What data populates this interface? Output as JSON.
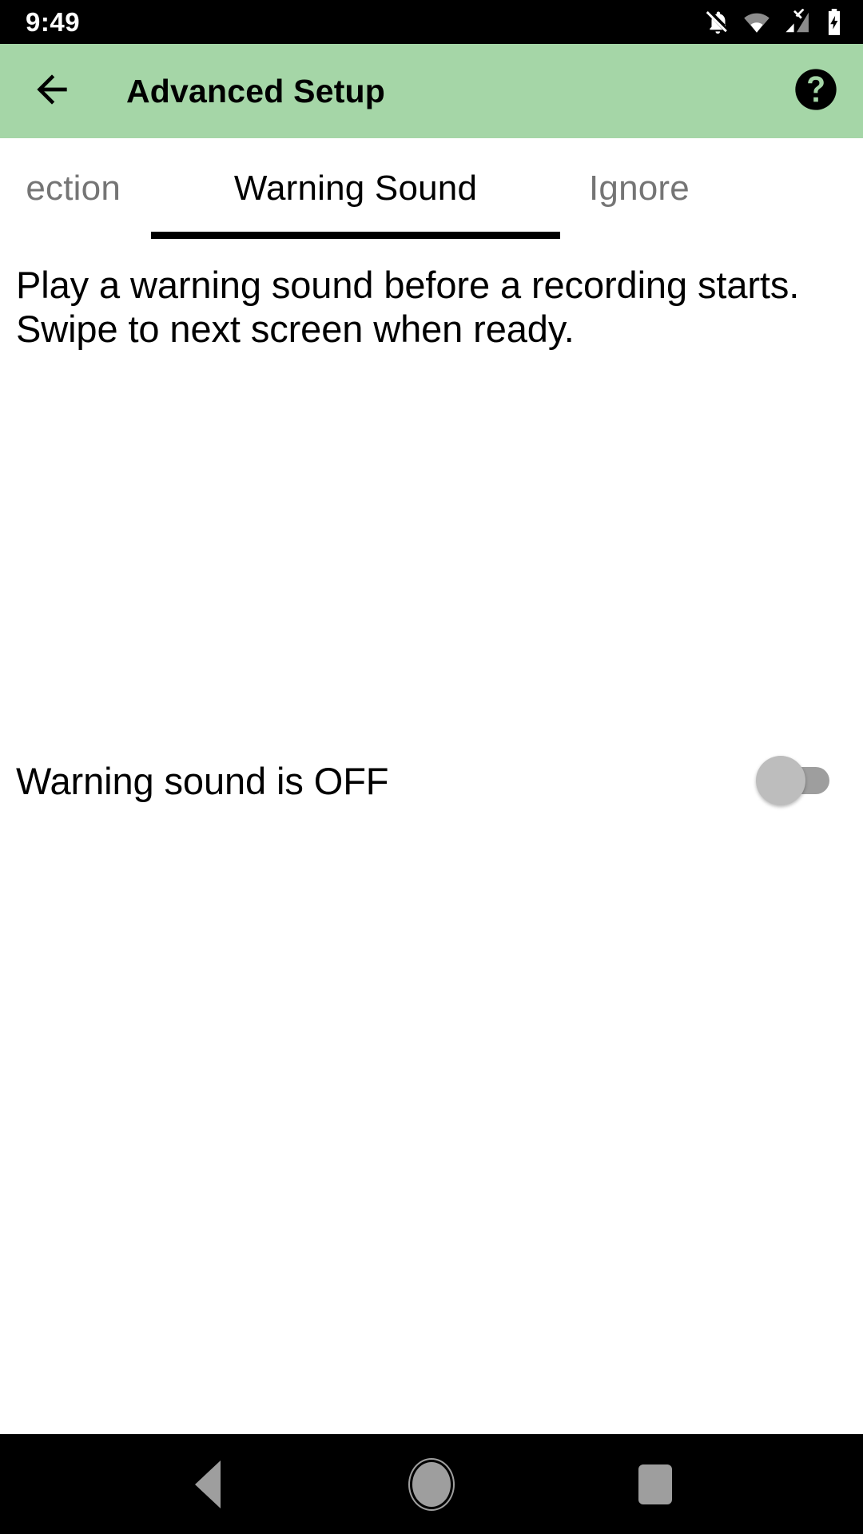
{
  "status_bar": {
    "clock": "9:49",
    "icons": [
      {
        "name": "notifications-off-icon"
      },
      {
        "name": "wifi-icon"
      },
      {
        "name": "cellular-no-sim-icon"
      },
      {
        "name": "battery-charging-icon"
      }
    ]
  },
  "app_bar": {
    "title": "Advanced Setup",
    "back_icon": "back-arrow-icon",
    "help_icon": "help-circle-icon",
    "background_color": "#a5d6a7"
  },
  "tabs": {
    "previous": "ection",
    "active": "Warning Sound",
    "next": "Ignore",
    "active_color": "#000000",
    "inactive_color": "#757575"
  },
  "main": {
    "description": "Play a warning sound before a recording starts. Swipe to next screen when ready.",
    "toggle": {
      "label": "Warning sound is OFF",
      "state": "off",
      "track_color": "#9e9e9e",
      "thumb_color": "#bdbdbd"
    }
  },
  "nav_bar": {
    "back_label": "back-triangle-icon",
    "home_label": "home-circle-icon",
    "recents_label": "recents-square-icon",
    "icon_color": "#9e9e9e"
  }
}
